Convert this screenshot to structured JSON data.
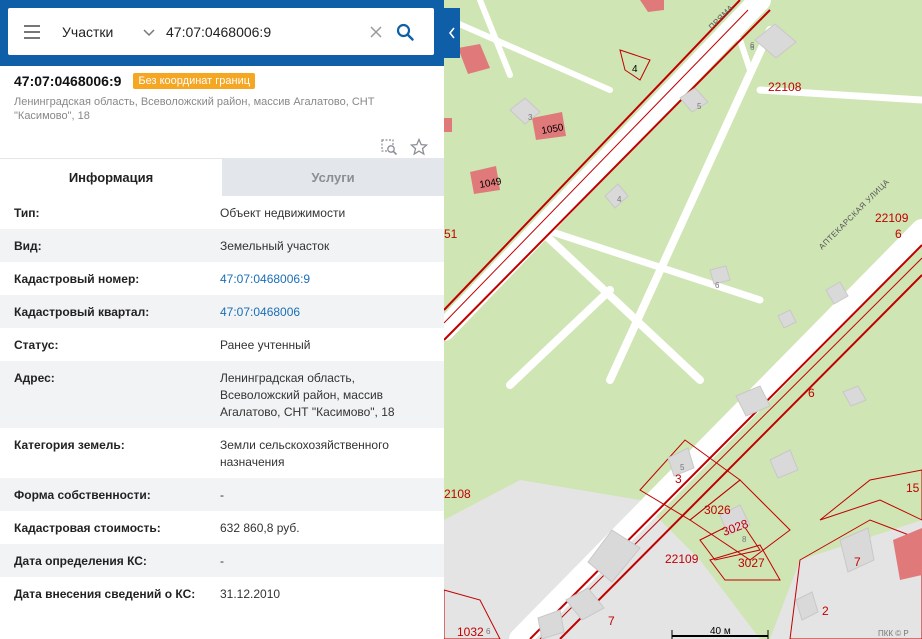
{
  "search": {
    "category": "Участки",
    "query": "47:07:0468006:9"
  },
  "object": {
    "cadastral_number": "47:07:0468006:9",
    "badge": "Без координат границ",
    "address": "Ленинградская область, Всеволожский район, массив Агалатово, СНТ \"Касимово\", 18"
  },
  "tabs": {
    "info": "Информация",
    "services": "Услуги"
  },
  "info_rows": [
    {
      "key": "Тип:",
      "value": "Объект недвижимости",
      "link": false
    },
    {
      "key": "Вид:",
      "value": "Земельный участок",
      "link": false
    },
    {
      "key": "Кадастровый номер:",
      "value": "47:07:0468006:9",
      "link": true
    },
    {
      "key": "Кадастровый квартал:",
      "value": "47:07:0468006",
      "link": true
    },
    {
      "key": "Статус:",
      "value": "Ранее учтенный",
      "link": false
    },
    {
      "key": "Адрес:",
      "value": "Ленинградская область, Всеволожский район, массив Агалатово, СНТ \"Касимово\", 18",
      "link": false
    },
    {
      "key": "Категория земель:",
      "value": "Земли сельскохозяйственного назначения",
      "link": false
    },
    {
      "key": "Форма собственности:",
      "value": "-",
      "link": false
    },
    {
      "key": "Кадастровая стоимость:",
      "value": "632 860,8 руб.",
      "link": false
    },
    {
      "key": "Дата определения КС:",
      "value": "-",
      "link": false
    },
    {
      "key": "Дата внесения сведений о КС:",
      "value": "31.12.2010",
      "link": false
    }
  ],
  "map": {
    "street_upper": "ПРЯМА",
    "street_diag": "АПТЕКАРСКАЯ УЛИЦА",
    "scale_label": "40 м",
    "copyright": "ПКК © Р",
    "parcel_labels": [
      "22108",
      "22109",
      "6",
      "6",
      "6",
      "2108",
      "22109",
      "3026",
      "3028",
      "3027",
      "3",
      "7",
      "2",
      "7",
      "15",
      "1032",
      "1050",
      "1049",
      "51",
      "4",
      "6"
    ],
    "house_numbers": [
      "5",
      "3",
      "4",
      "6",
      "5",
      "8",
      "6"
    ],
    "colors": {
      "land": "#cfe5b4",
      "road": "#ffffff",
      "boundary": "#c00000",
      "building": "#e07a7a",
      "gray_building": "#d9d9d9",
      "panel_header": "#0e5ea8",
      "badge": "#f5a623",
      "link": "#1a6fb8"
    }
  }
}
